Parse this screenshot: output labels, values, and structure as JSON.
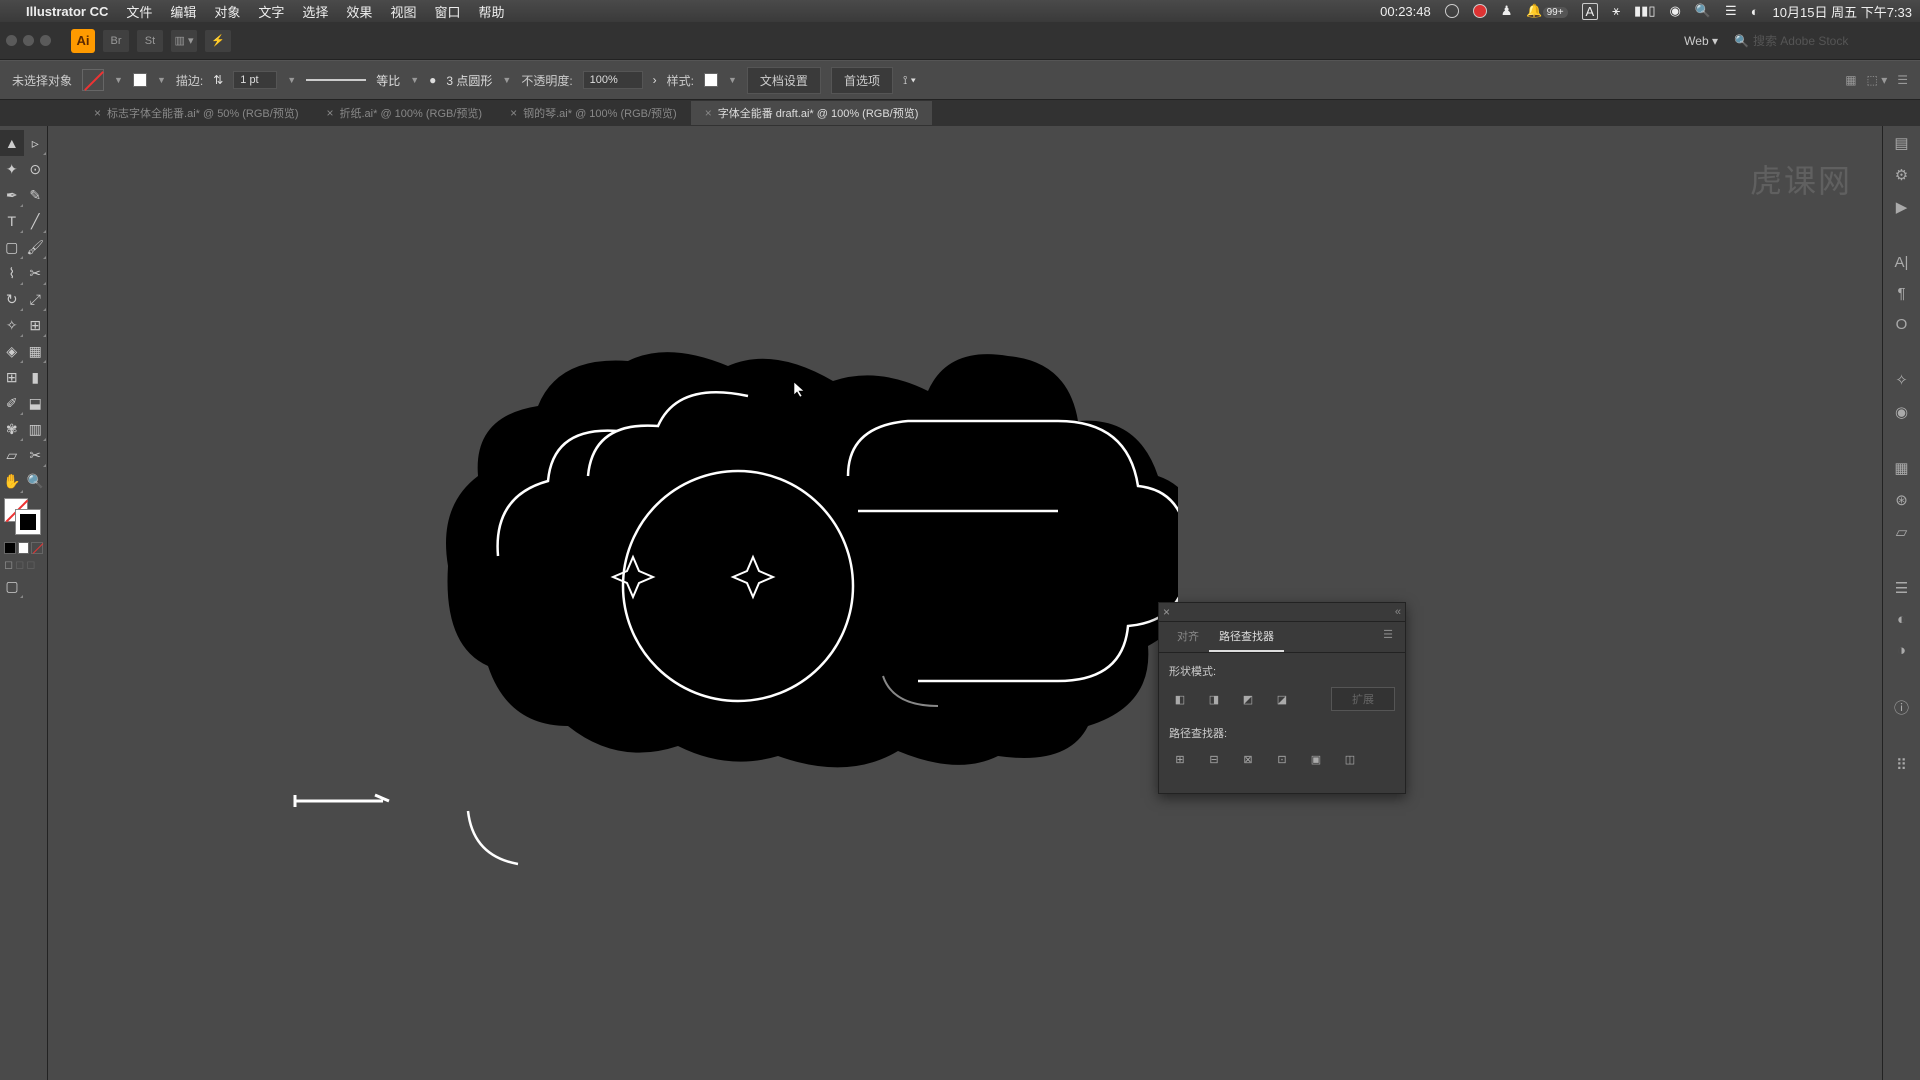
{
  "menubar": {
    "app_name": "Illustrator CC",
    "items": [
      "文件",
      "编辑",
      "对象",
      "文字",
      "选择",
      "效果",
      "视图",
      "窗口",
      "帮助"
    ],
    "timer": "00:23:48",
    "notif_count": "99+",
    "date_time": "10月15日 周五 下午7:33"
  },
  "header": {
    "web_label": "Web",
    "search_placeholder": "搜索 Adobe Stock"
  },
  "control": {
    "selection_state": "未选择对象",
    "stroke_label": "描边:",
    "stroke_weight": "1 pt",
    "stroke_type": "等比",
    "profile": "3 点圆形",
    "opacity_label": "不透明度:",
    "opacity_value": "100%",
    "style_label": "样式:",
    "doc_setup": "文档设置",
    "preferences": "首选项"
  },
  "tabs": [
    {
      "label": "标志字体全能番.ai* @ 50% (RGB/预览)",
      "active": false
    },
    {
      "label": "折纸.ai* @ 100% (RGB/预览)",
      "active": false
    },
    {
      "label": "钢的琴.ai* @ 100% (RGB/预览)",
      "active": false
    },
    {
      "label": "字体全能番 draft.ai* @ 100% (RGB/预览)",
      "active": true
    }
  ],
  "pathfinder": {
    "tab_align": "对齐",
    "tab_pathfinder": "路径查找器",
    "shape_mode_label": "形状模式:",
    "pathfinder_label": "路径查找器:",
    "expand_label": "扩展"
  },
  "watermark_text": "虎课网"
}
